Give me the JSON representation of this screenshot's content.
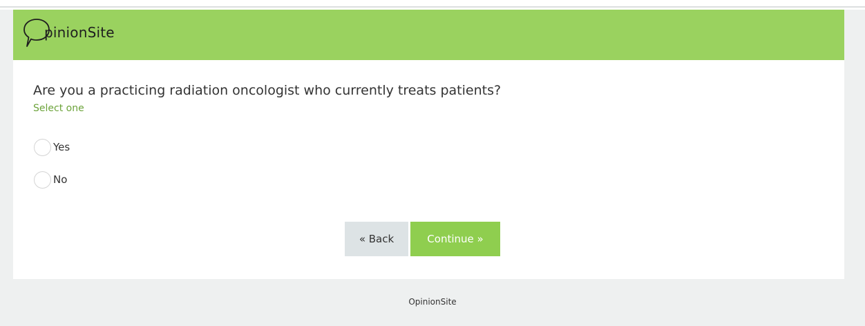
{
  "brand": {
    "logo_text": "pinionSite",
    "header_color": "#9ad25f"
  },
  "question": {
    "text": "Are you a practicing radiation oncologist who currently treats patients?",
    "hint": "Select one",
    "options": [
      {
        "label": "Yes",
        "selected": false
      },
      {
        "label": "No",
        "selected": false
      }
    ]
  },
  "navigation": {
    "back_label": "« Back",
    "continue_label": "Continue »",
    "continue_color": "#8fce4f"
  },
  "footer": {
    "text": "OpinionSite"
  }
}
